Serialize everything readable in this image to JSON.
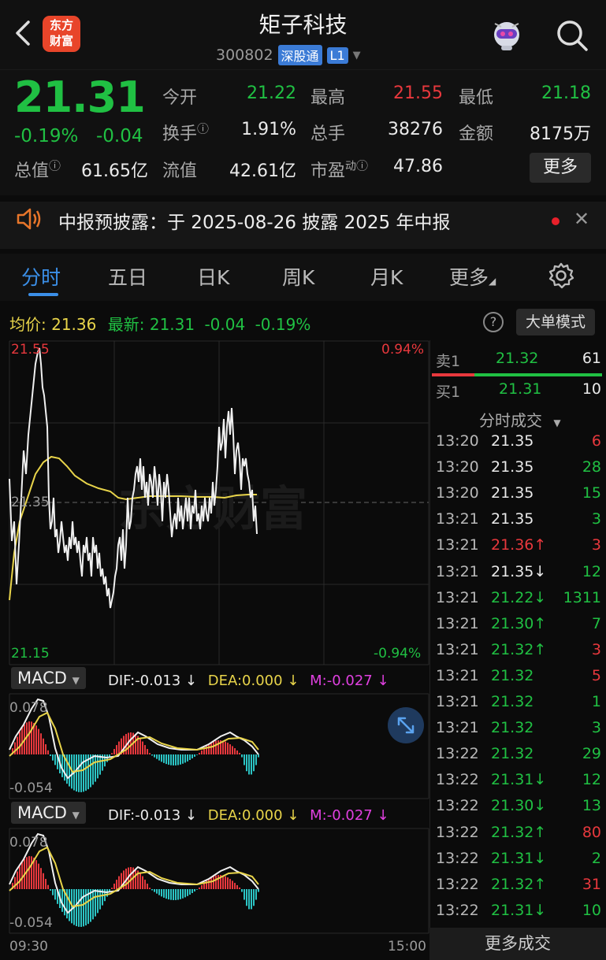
{
  "header": {
    "title": "矩子科技",
    "code": "300802",
    "market_tag": "深股通",
    "level_tag": "L1",
    "logo_line1": "东方",
    "logo_line2": "财富"
  },
  "quote": {
    "price": "21.31",
    "pct": "-0.19%",
    "change": "-0.04",
    "open_label": "今开",
    "open": "21.22",
    "high_label": "最高",
    "high": "21.55",
    "low_label": "最低",
    "low": "21.18",
    "turnover_label": "换手",
    "turnover": "1.91%",
    "volume_label": "总手",
    "volume": "38276",
    "amount_label": "金额",
    "amount": "8175万",
    "mktcap_label": "总值",
    "mktcap": "61.65亿",
    "float_label": "流值",
    "float": "42.61亿",
    "pe_label": "市盈",
    "pe_sup": "动",
    "pe": "47.86",
    "more_label": "更多"
  },
  "notice": {
    "text": "中报预披露：于 2025-08-26 披露 2025 年中报"
  },
  "tabs": [
    "分时",
    "五日",
    "日K",
    "周K",
    "月K",
    "更多"
  ],
  "avg_row": {
    "avg_label": "均价:",
    "avg": "21.36",
    "latest_label": "最新:",
    "latest": "21.31",
    "change": "-0.04",
    "pct": "-0.19%",
    "bigorder_label": "大单模式",
    "help_label": "?"
  },
  "chart": {
    "top_price": "21.55",
    "mid_price": "21.35",
    "bottom_price": "21.15",
    "top_pct": "0.94%",
    "bottom_pct": "-0.94%",
    "watermark": "东方财富",
    "time_start": "09:30",
    "time_end": "15:00"
  },
  "macd": {
    "selector": "MACD",
    "dif": "DIF:-0.013 ↓",
    "dea": "DEA:0.000 ↓",
    "m": "M:-0.027 ↓",
    "top": "0.078",
    "bottom": "-0.054"
  },
  "book": {
    "sell_label": "卖1",
    "sell_price": "21.32",
    "sell_vol": "61",
    "buy_label": "买1",
    "buy_price": "21.31",
    "buy_vol": "10",
    "header": "分时成交",
    "more": "更多成交"
  },
  "trades": [
    {
      "time": "13:20",
      "price": "21.35",
      "vol": "6",
      "pc": "white",
      "vc": "red"
    },
    {
      "time": "13:20",
      "price": "21.35",
      "vol": "28",
      "pc": "white",
      "vc": "green"
    },
    {
      "time": "13:20",
      "price": "21.35",
      "vol": "15",
      "pc": "white",
      "vc": "green"
    },
    {
      "time": "13:21",
      "price": "21.35",
      "vol": "3",
      "pc": "white",
      "vc": "green"
    },
    {
      "time": "13:21",
      "price": "21.36↑",
      "vol": "3",
      "pc": "red",
      "vc": "red"
    },
    {
      "time": "13:21",
      "price": "21.35↓",
      "vol": "12",
      "pc": "white",
      "vc": "green"
    },
    {
      "time": "13:21",
      "price": "21.22↓",
      "vol": "1311",
      "pc": "green",
      "vc": "green"
    },
    {
      "time": "13:21",
      "price": "21.30↑",
      "vol": "7",
      "pc": "green",
      "vc": "green"
    },
    {
      "time": "13:21",
      "price": "21.32↑",
      "vol": "3",
      "pc": "green",
      "vc": "red"
    },
    {
      "time": "13:21",
      "price": "21.32",
      "vol": "5",
      "pc": "green",
      "vc": "red"
    },
    {
      "time": "13:21",
      "price": "21.32",
      "vol": "1",
      "pc": "green",
      "vc": "green"
    },
    {
      "time": "13:21",
      "price": "21.32",
      "vol": "3",
      "pc": "green",
      "vc": "green"
    },
    {
      "time": "13:22",
      "price": "21.32",
      "vol": "29",
      "pc": "green",
      "vc": "green"
    },
    {
      "time": "13:22",
      "price": "21.31↓",
      "vol": "12",
      "pc": "green",
      "vc": "green"
    },
    {
      "time": "13:22",
      "price": "21.30↓",
      "vol": "13",
      "pc": "green",
      "vc": "green"
    },
    {
      "time": "13:22",
      "price": "21.32↑",
      "vol": "80",
      "pc": "green",
      "vc": "red"
    },
    {
      "time": "13:22",
      "price": "21.31↓",
      "vol": "2",
      "pc": "green",
      "vc": "green"
    },
    {
      "time": "13:22",
      "price": "21.32↑",
      "vol": "31",
      "pc": "green",
      "vc": "red"
    },
    {
      "time": "13:22",
      "price": "21.31↓",
      "vol": "10",
      "pc": "green",
      "vc": "green"
    }
  ],
  "colors": {
    "up": "#e8383d",
    "down": "#20c043",
    "accent": "#3b8fe8",
    "avg_line": "#e8d44a"
  }
}
